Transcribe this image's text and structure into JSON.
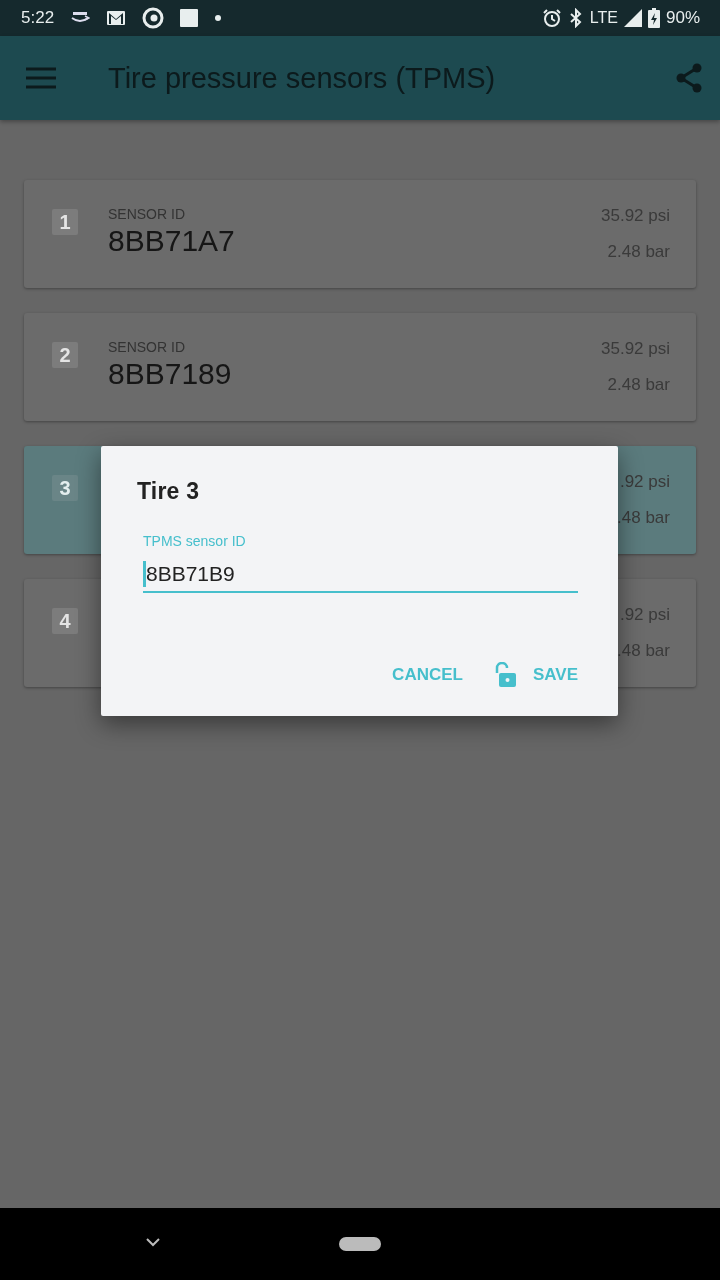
{
  "status_bar": {
    "time": "5:22",
    "network": "LTE",
    "battery": "90%"
  },
  "app_bar": {
    "title": "Tire pressure sensors (TPMS)"
  },
  "sensors": [
    {
      "number": "1",
      "label": "SENSOR ID",
      "sensor_id": "8BB71A7",
      "psi": "35.92 psi",
      "bar": "2.48 bar",
      "selected": false
    },
    {
      "number": "2",
      "label": "SENSOR ID",
      "sensor_id": "8BB7189",
      "psi": "35.92 psi",
      "bar": "2.48 bar",
      "selected": false
    },
    {
      "number": "3",
      "psi": ".92 psi",
      "bar": ".48 bar",
      "selected": true
    },
    {
      "number": "4",
      "psi": ".92 psi",
      "bar": ".48 bar",
      "selected": false
    }
  ],
  "dialog": {
    "title": "Tire 3",
    "field_label": "TPMS sensor ID",
    "value": "8BB71B9",
    "buttons": [
      {
        "kind": "text",
        "label": "CANCEL"
      },
      {
        "kind": "lock",
        "label": "SAVE"
      }
    ]
  }
}
